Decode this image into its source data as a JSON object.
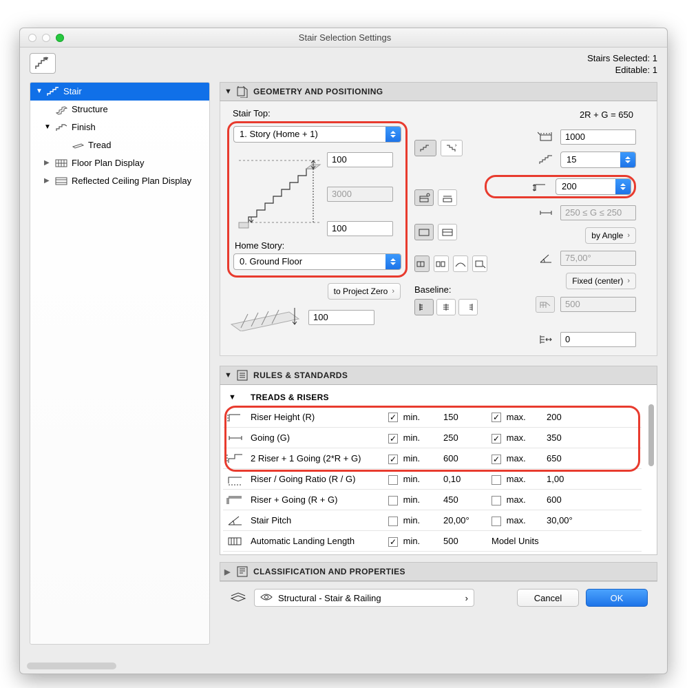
{
  "title": "Stair Selection Settings",
  "selinfo": {
    "l1": "Stairs Selected: 1",
    "l2": "Editable: 1"
  },
  "tree": {
    "stair": "Stair",
    "structure": "Structure",
    "finish": "Finish",
    "tread": "Tread",
    "floorplan": "Floor Plan Display",
    "rcp": "Reflected Ceiling Plan Display"
  },
  "geo": {
    "header": "GEOMETRY AND POSITIONING",
    "stairtop_label": "Stair Top:",
    "stairtop_value": "1. Story (Home + 1)",
    "top_offset": "100",
    "height": "3000",
    "bottom_offset": "100",
    "homestory_label": "Home Story:",
    "homestory_value": "0. Ground Floor",
    "project_zero": "to Project Zero",
    "pz_value": "100",
    "formula": "2R + G = 650",
    "width": "1000",
    "steps": "15",
    "riser": "200",
    "going_range": "250 ≤ G ≤ 250",
    "by_angle": "by Angle",
    "angle": "75,00°",
    "fixed": "Fixed (center)",
    "fixed_val": "500",
    "baseline_label": "Baseline:",
    "baseline_val": "0"
  },
  "rules": {
    "header": "RULES & STANDARDS",
    "subheader": "TREADS & RISERS",
    "min": "min.",
    "max": "max.",
    "rows": [
      {
        "name": "Riser Height (R)",
        "minOn": true,
        "minV": "150",
        "maxOn": true,
        "maxV": "200"
      },
      {
        "name": "Going (G)",
        "minOn": true,
        "minV": "250",
        "maxOn": true,
        "maxV": "350"
      },
      {
        "name": "2 Riser + 1 Going (2*R + G)",
        "minOn": true,
        "minV": "600",
        "maxOn": true,
        "maxV": "650"
      },
      {
        "name": "Riser / Going Ratio (R / G)",
        "minOn": false,
        "minV": "0,10",
        "maxOn": false,
        "maxV": "1,00"
      },
      {
        "name": "Riser + Going (R + G)",
        "minOn": false,
        "minV": "450",
        "maxOn": false,
        "maxV": "600"
      },
      {
        "name": "Stair Pitch",
        "minOn": false,
        "minV": "20,00°",
        "maxOn": false,
        "maxV": "30,00°"
      },
      {
        "name": "Automatic Landing Length",
        "minOn": true,
        "minV": "500",
        "maxOn": null,
        "maxV": "Model Units"
      }
    ]
  },
  "class_header": "CLASSIFICATION AND PROPERTIES",
  "footer": {
    "layer": "Structural - Stair & Railing",
    "cancel": "Cancel",
    "ok": "OK"
  }
}
